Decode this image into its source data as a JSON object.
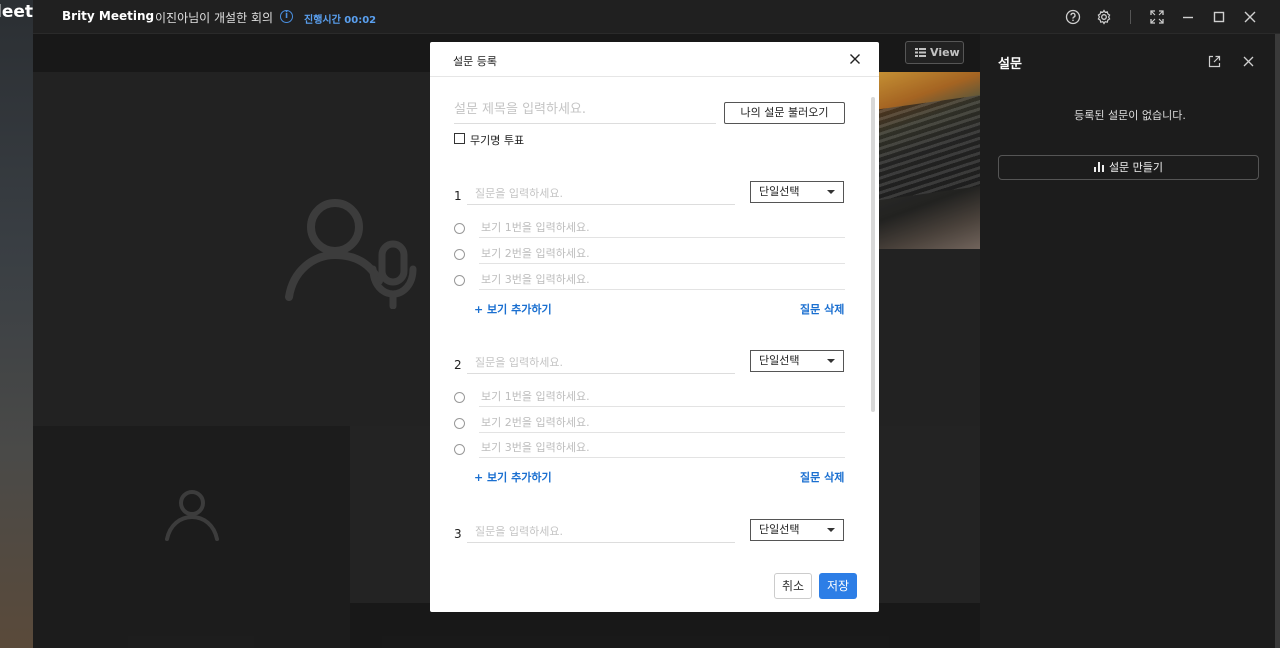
{
  "desktop": {
    "text": "leet"
  },
  "titlebar": {
    "app_name": "Brity Meeting",
    "meeting_title": "이진아님이 개설한 회의",
    "elapsed": "진행시간 00:02",
    "icons": [
      "help-icon",
      "settings-icon",
      "fullscreen-icon",
      "minimize-icon",
      "maximize-icon",
      "close-icon"
    ]
  },
  "stage": {
    "view_label": "View"
  },
  "panel": {
    "title": "설문",
    "empty_message": "등록된 설문이 없습니다.",
    "create_label": "설문 만들기"
  },
  "modal": {
    "title": "설문 등록",
    "survey_title_placeholder": "설문 제목을 입력하세요.",
    "load_label": "나의 설문 불러오기",
    "anonymous_label": "무기명 투표",
    "questions": [
      {
        "number": "1",
        "placeholder": "질문을 입력하세요.",
        "type": "단일선택",
        "options": [
          "보기 1번을 입력하세요.",
          "보기 2번을 입력하세요.",
          "보기 3번을 입력하세요."
        ],
        "add_label": "+ 보기 추가하기",
        "delete_label": "질문 삭제"
      },
      {
        "number": "2",
        "placeholder": "질문을 입력하세요.",
        "type": "단일선택",
        "options": [
          "보기 1번을 입력하세요.",
          "보기 2번을 입력하세요.",
          "보기 3번을 입력하세요."
        ],
        "add_label": "+ 보기 추가하기",
        "delete_label": "질문 삭제"
      },
      {
        "number": "3",
        "placeholder": "질문을 입력하세요.",
        "type": "단일선택"
      }
    ],
    "cancel_label": "취소",
    "save_label": "저장"
  },
  "colors": {
    "accent": "#2d7ee6",
    "link": "#1a6fd0",
    "elapsed": "#5aa0f0"
  }
}
